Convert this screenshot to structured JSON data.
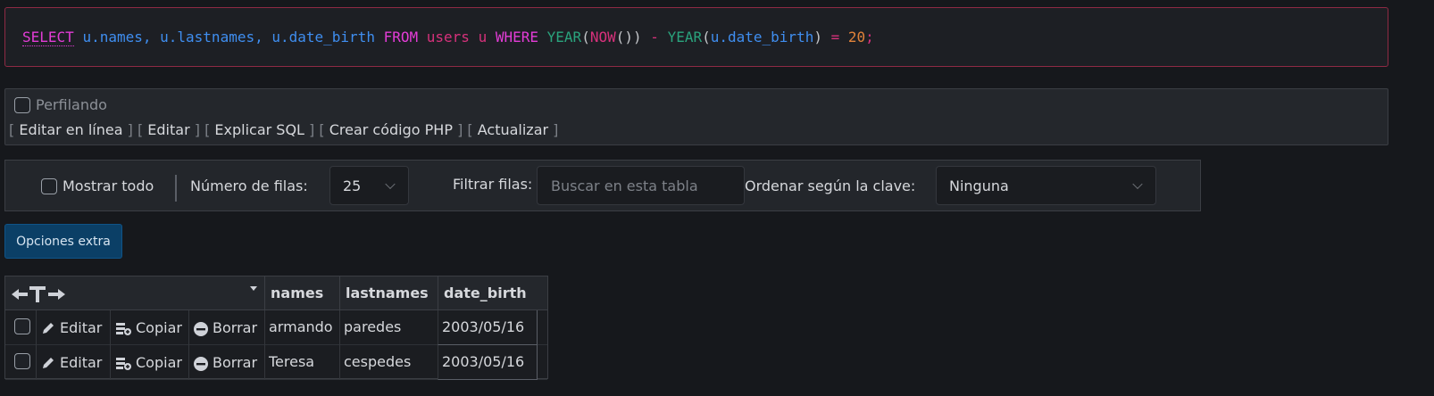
{
  "sql": {
    "select": "SELECT",
    "cols": "u.names, u.lastnames, u.date_birth",
    "from": "FROM",
    "table": "users u",
    "where": "WHERE",
    "fn_year": "YEAR",
    "fn_now": "NOW",
    "minus": "-",
    "arg_col": "u.date_birth",
    "eq": "=",
    "num": "20",
    "end": ";"
  },
  "profiling": {
    "label": "Perfilando",
    "links": [
      "Editar en línea",
      "Editar",
      "Explicar SQL",
      "Crear código PHP",
      "Actualizar"
    ]
  },
  "navigation": {
    "show_all": "Mostrar todo",
    "rows_label": "Número de filas:",
    "rows_value": "25",
    "filter_label": "Filtrar filas:",
    "filter_placeholder": "Buscar en esta tabla",
    "sort_label": "Ordenar según la clave:",
    "sort_value": "Ninguna"
  },
  "extra_options": "Opciones extra",
  "table": {
    "columns": [
      "names",
      "lastnames",
      "date_birth"
    ],
    "actions": {
      "edit": "Editar",
      "copy": "Copiar",
      "delete": "Borrar"
    },
    "rows": [
      {
        "names": "armando",
        "lastnames": "paredes",
        "date_birth": "2003/05/16"
      },
      {
        "names": "Teresa",
        "lastnames": "cespedes",
        "date_birth": "2003/05/16"
      }
    ]
  },
  "colors": {
    "sql_border": "#8e2a44",
    "button_bg": "#0b3f66",
    "page_bg": "#16181c"
  }
}
